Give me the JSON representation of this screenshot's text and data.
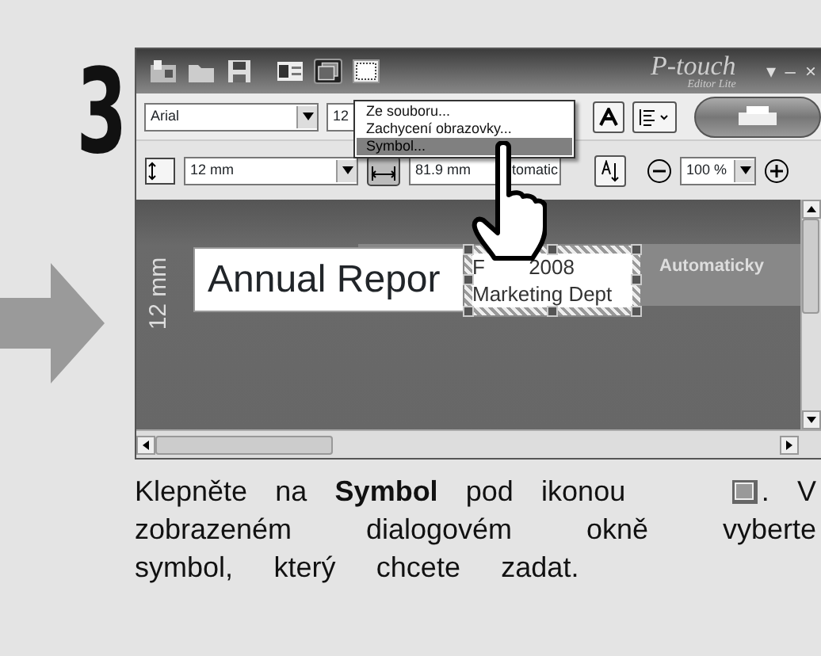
{
  "step": "3",
  "title_bar": {
    "logo": "P-touch",
    "logo_sub": "Editor Lite",
    "controls": [
      "▾",
      "–",
      "×"
    ]
  },
  "format_bar": {
    "font": "Arial",
    "size": "12"
  },
  "insert_menu": {
    "items": [
      {
        "label": "Ze souboru...",
        "selected": false
      },
      {
        "label": "Zachycení obrazovky...",
        "selected": false
      },
      {
        "label": "Symbol...",
        "selected": true
      }
    ]
  },
  "size_bar": {
    "tape_width": "12 mm",
    "length": "81.9 mm",
    "length_mode": "tomatic",
    "zoom": "100 %"
  },
  "canvas": {
    "ruler_label": "12 mm",
    "label_text": "Annual Repor",
    "object_fragment": "F",
    "object_year": "2008",
    "object_dept": "Marketing Dept",
    "length_label": "Automaticky"
  },
  "instruction": {
    "before": "Klepněte na **Symbol** pod ikonou",
    "after": ". V",
    "rest": "zobrazeném dialogovém okně vyberte symbol, který chcete zadat."
  }
}
